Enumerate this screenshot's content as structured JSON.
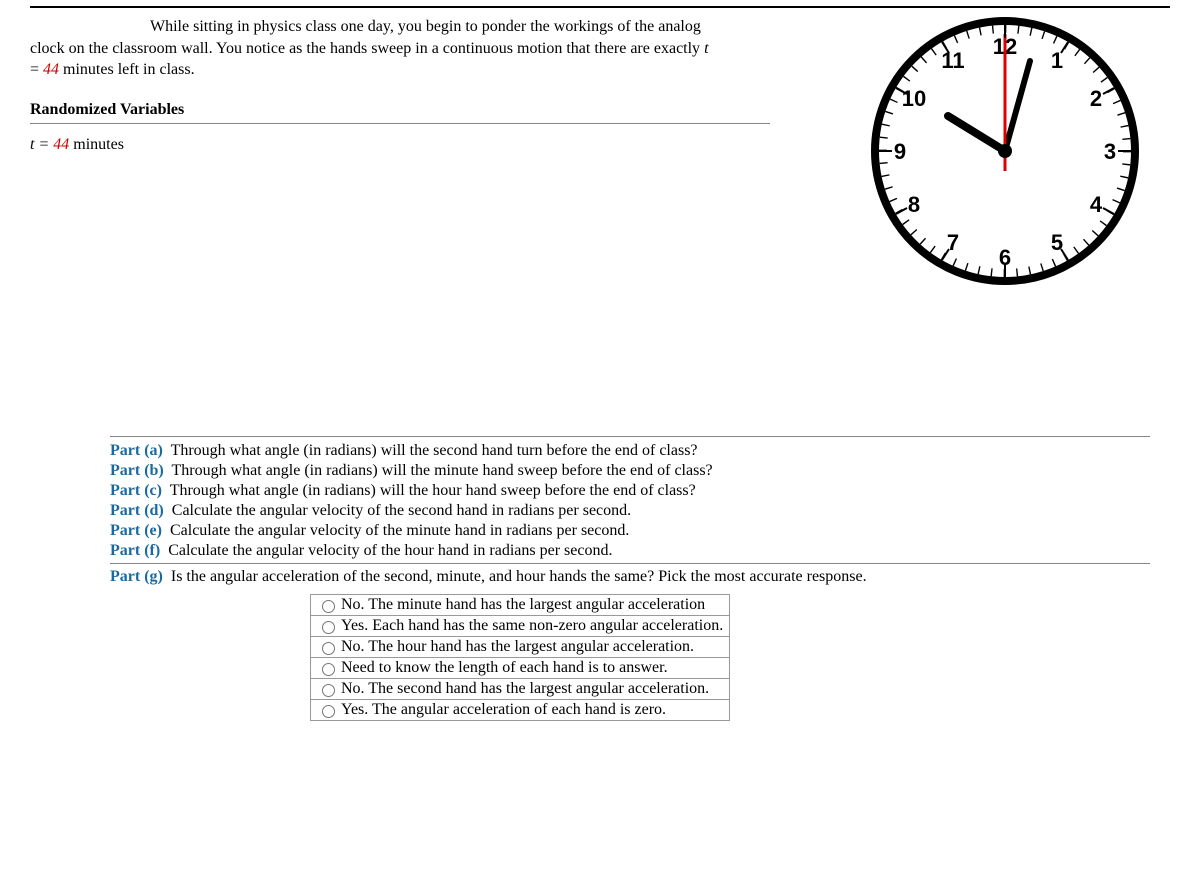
{
  "problem": {
    "intro": "While sitting in physics class one day, you begin to ponder the workings of the analog clock on the classroom wall. You notice as the hands sweep in a continuous motion that there are exactly t = 44 minutes left in class.",
    "rv_heading": "Randomized Variables",
    "rv_prefix": "t = ",
    "rv_value": "44",
    "rv_suffix": " minutes"
  },
  "clock": {
    "numbers": [
      "12",
      "1",
      "2",
      "3",
      "4",
      "5",
      "6",
      "7",
      "8",
      "9",
      "10",
      "11"
    ]
  },
  "parts": [
    {
      "label": "Part (a)",
      "text": "Through what angle (in radians) will the second hand turn before the end of class?"
    },
    {
      "label": "Part (b)",
      "text": "Through what angle (in radians) will the minute hand sweep before the end of class?"
    },
    {
      "label": "Part (c)",
      "text": "Through what angle (in radians) will the hour hand sweep before the end of class?"
    },
    {
      "label": "Part (d)",
      "text": "Calculate the angular velocity of the second hand in radians per second."
    },
    {
      "label": "Part (e)",
      "text": "Calculate the angular velocity of the minute hand in radians per second."
    },
    {
      "label": "Part (f)",
      "text": "Calculate the angular velocity of the hour hand in radians per second."
    }
  ],
  "part_g": {
    "label": "Part (g)",
    "text": "Is the angular acceleration of the second, minute, and hour hands the same? Pick the most accurate response."
  },
  "options": [
    "No. The minute hand has the largest angular acceleration",
    "Yes. Each hand has the same non-zero angular acceleration.",
    "No. The hour hand has the largest angular acceleration.",
    "Need to know the length of each hand is to answer.",
    "No. The second hand has the largest angular acceleration.",
    "Yes. The angular acceleration of each hand is zero."
  ]
}
